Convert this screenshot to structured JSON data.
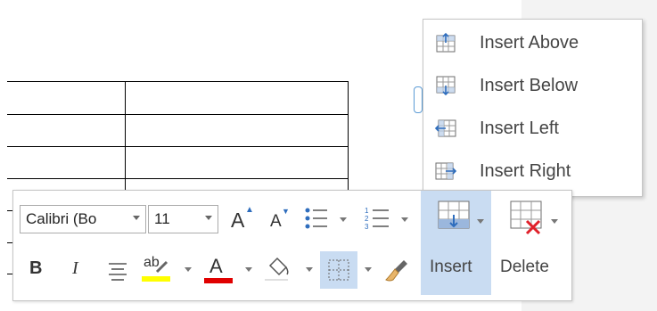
{
  "context_menu": {
    "items": [
      {
        "label": "Insert Above",
        "icon": "insert-above-icon"
      },
      {
        "label": "Insert Below",
        "icon": "insert-below-icon"
      },
      {
        "label": "Insert Left",
        "icon": "insert-left-icon"
      },
      {
        "label": "Insert Right",
        "icon": "insert-right-icon"
      }
    ]
  },
  "mini_toolbar": {
    "font_name": "Calibri (Bo",
    "font_size": "11",
    "grow_font_glyph": "A",
    "shrink_font_glyph": "A",
    "bold_glyph": "B",
    "italic_glyph": "I",
    "highlight_glyph": "ab",
    "font_color_glyph": "A",
    "insert_label": "Insert",
    "delete_label": "Delete",
    "colors": {
      "highlight": "#ffff00",
      "font_color": "#e00000",
      "accent": "#4a7fc1",
      "selected_bg": "#c9dcf2"
    }
  }
}
